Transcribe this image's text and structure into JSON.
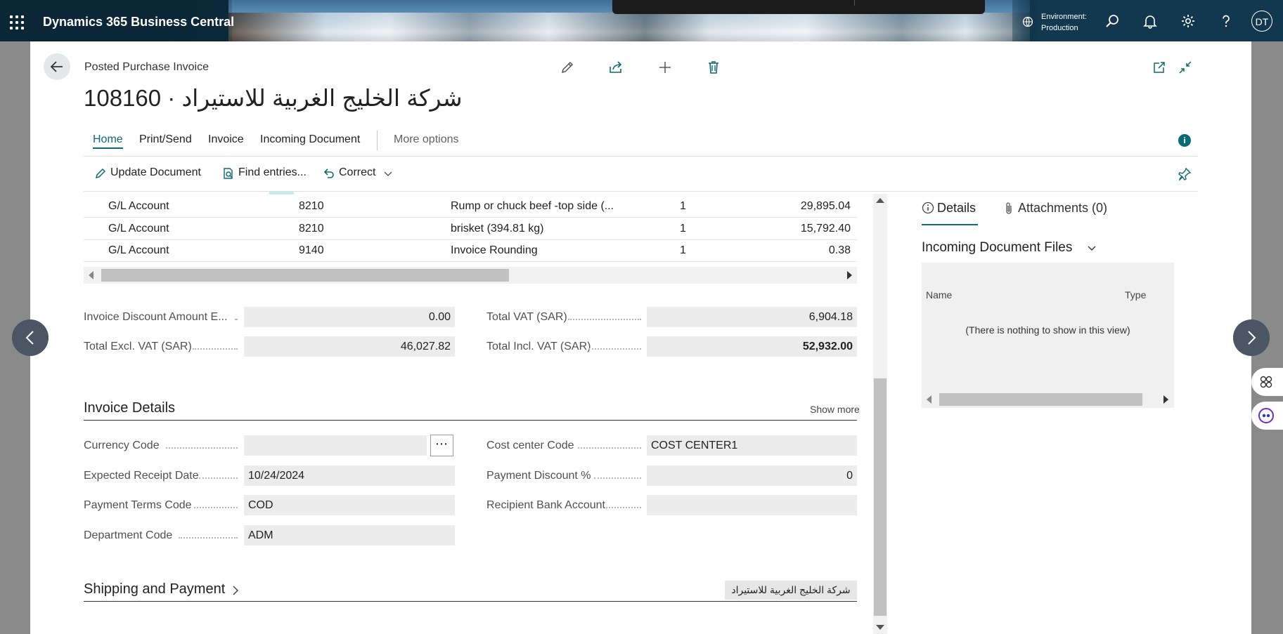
{
  "topbar": {
    "app_name": "Dynamics 365 Business Central",
    "environment_label": "Environment:",
    "environment_value": "Production",
    "user_initials": "DT"
  },
  "header": {
    "breadcrumb": "Posted Purchase Invoice",
    "title": "شركة الخليج الغربية للاستيراد · 108160"
  },
  "tabs": [
    {
      "label": "Home"
    },
    {
      "label": "Print/Send"
    },
    {
      "label": "Invoice"
    },
    {
      "label": "Incoming Document"
    }
  ],
  "more_options": "More options",
  "actions": {
    "update_document": "Update Document",
    "find_entries": "Find entries...",
    "correct": "Correct"
  },
  "lines": [
    {
      "type": "G/L Account",
      "no": "8210",
      "description": "Rump or chuck beef -top side (...",
      "quantity": "1",
      "amount": "29,895.04"
    },
    {
      "type": "G/L Account",
      "no": "8210",
      "description": "brisket (394.81 kg)",
      "quantity": "1",
      "amount": "15,792.40"
    },
    {
      "type": "G/L Account",
      "no": "9140",
      "description": "Invoice Rounding",
      "quantity": "1",
      "amount": "0.38"
    }
  ],
  "totals": {
    "inv_discount_label": "Invoice Discount Amount E...",
    "inv_discount_value": "0.00",
    "total_excl_label": "Total Excl. VAT (SAR)",
    "total_excl_value": "46,027.82",
    "total_vat_label": "Total VAT (SAR)",
    "total_vat_value": "6,904.18",
    "total_incl_label": "Total Incl. VAT (SAR)",
    "total_incl_value": "52,932.00"
  },
  "invoice_details": {
    "section_title": "Invoice Details",
    "show_more": "Show more",
    "currency_code_label": "Currency Code",
    "currency_code_value": "",
    "expected_receipt_label": "Expected Receipt Date",
    "expected_receipt_value": "10/24/2024",
    "payment_terms_label": "Payment Terms Code",
    "payment_terms_value": "COD",
    "department_label": "Department Code",
    "department_value": "ADM",
    "cost_center_label": "Cost center Code",
    "cost_center_value": "COST CENTER1",
    "payment_discount_label": "Payment Discount %",
    "payment_discount_value": "0",
    "recipient_bank_label": "Recipient Bank Account",
    "recipient_bank_value": ""
  },
  "shipping": {
    "section_title": "Shipping and Payment",
    "badge": "شركة الخليج الغربية للاستيراد"
  },
  "factbox": {
    "details_tab": "Details",
    "attachments_tab": "Attachments (0)",
    "heading": "Incoming Document Files",
    "col_name": "Name",
    "col_type": "Type",
    "empty_text": "(There is nothing to show in this view)"
  },
  "colors": {
    "accent": "#0b6a74",
    "topbar": "#0b2a3a",
    "field_bg": "#ececec"
  }
}
